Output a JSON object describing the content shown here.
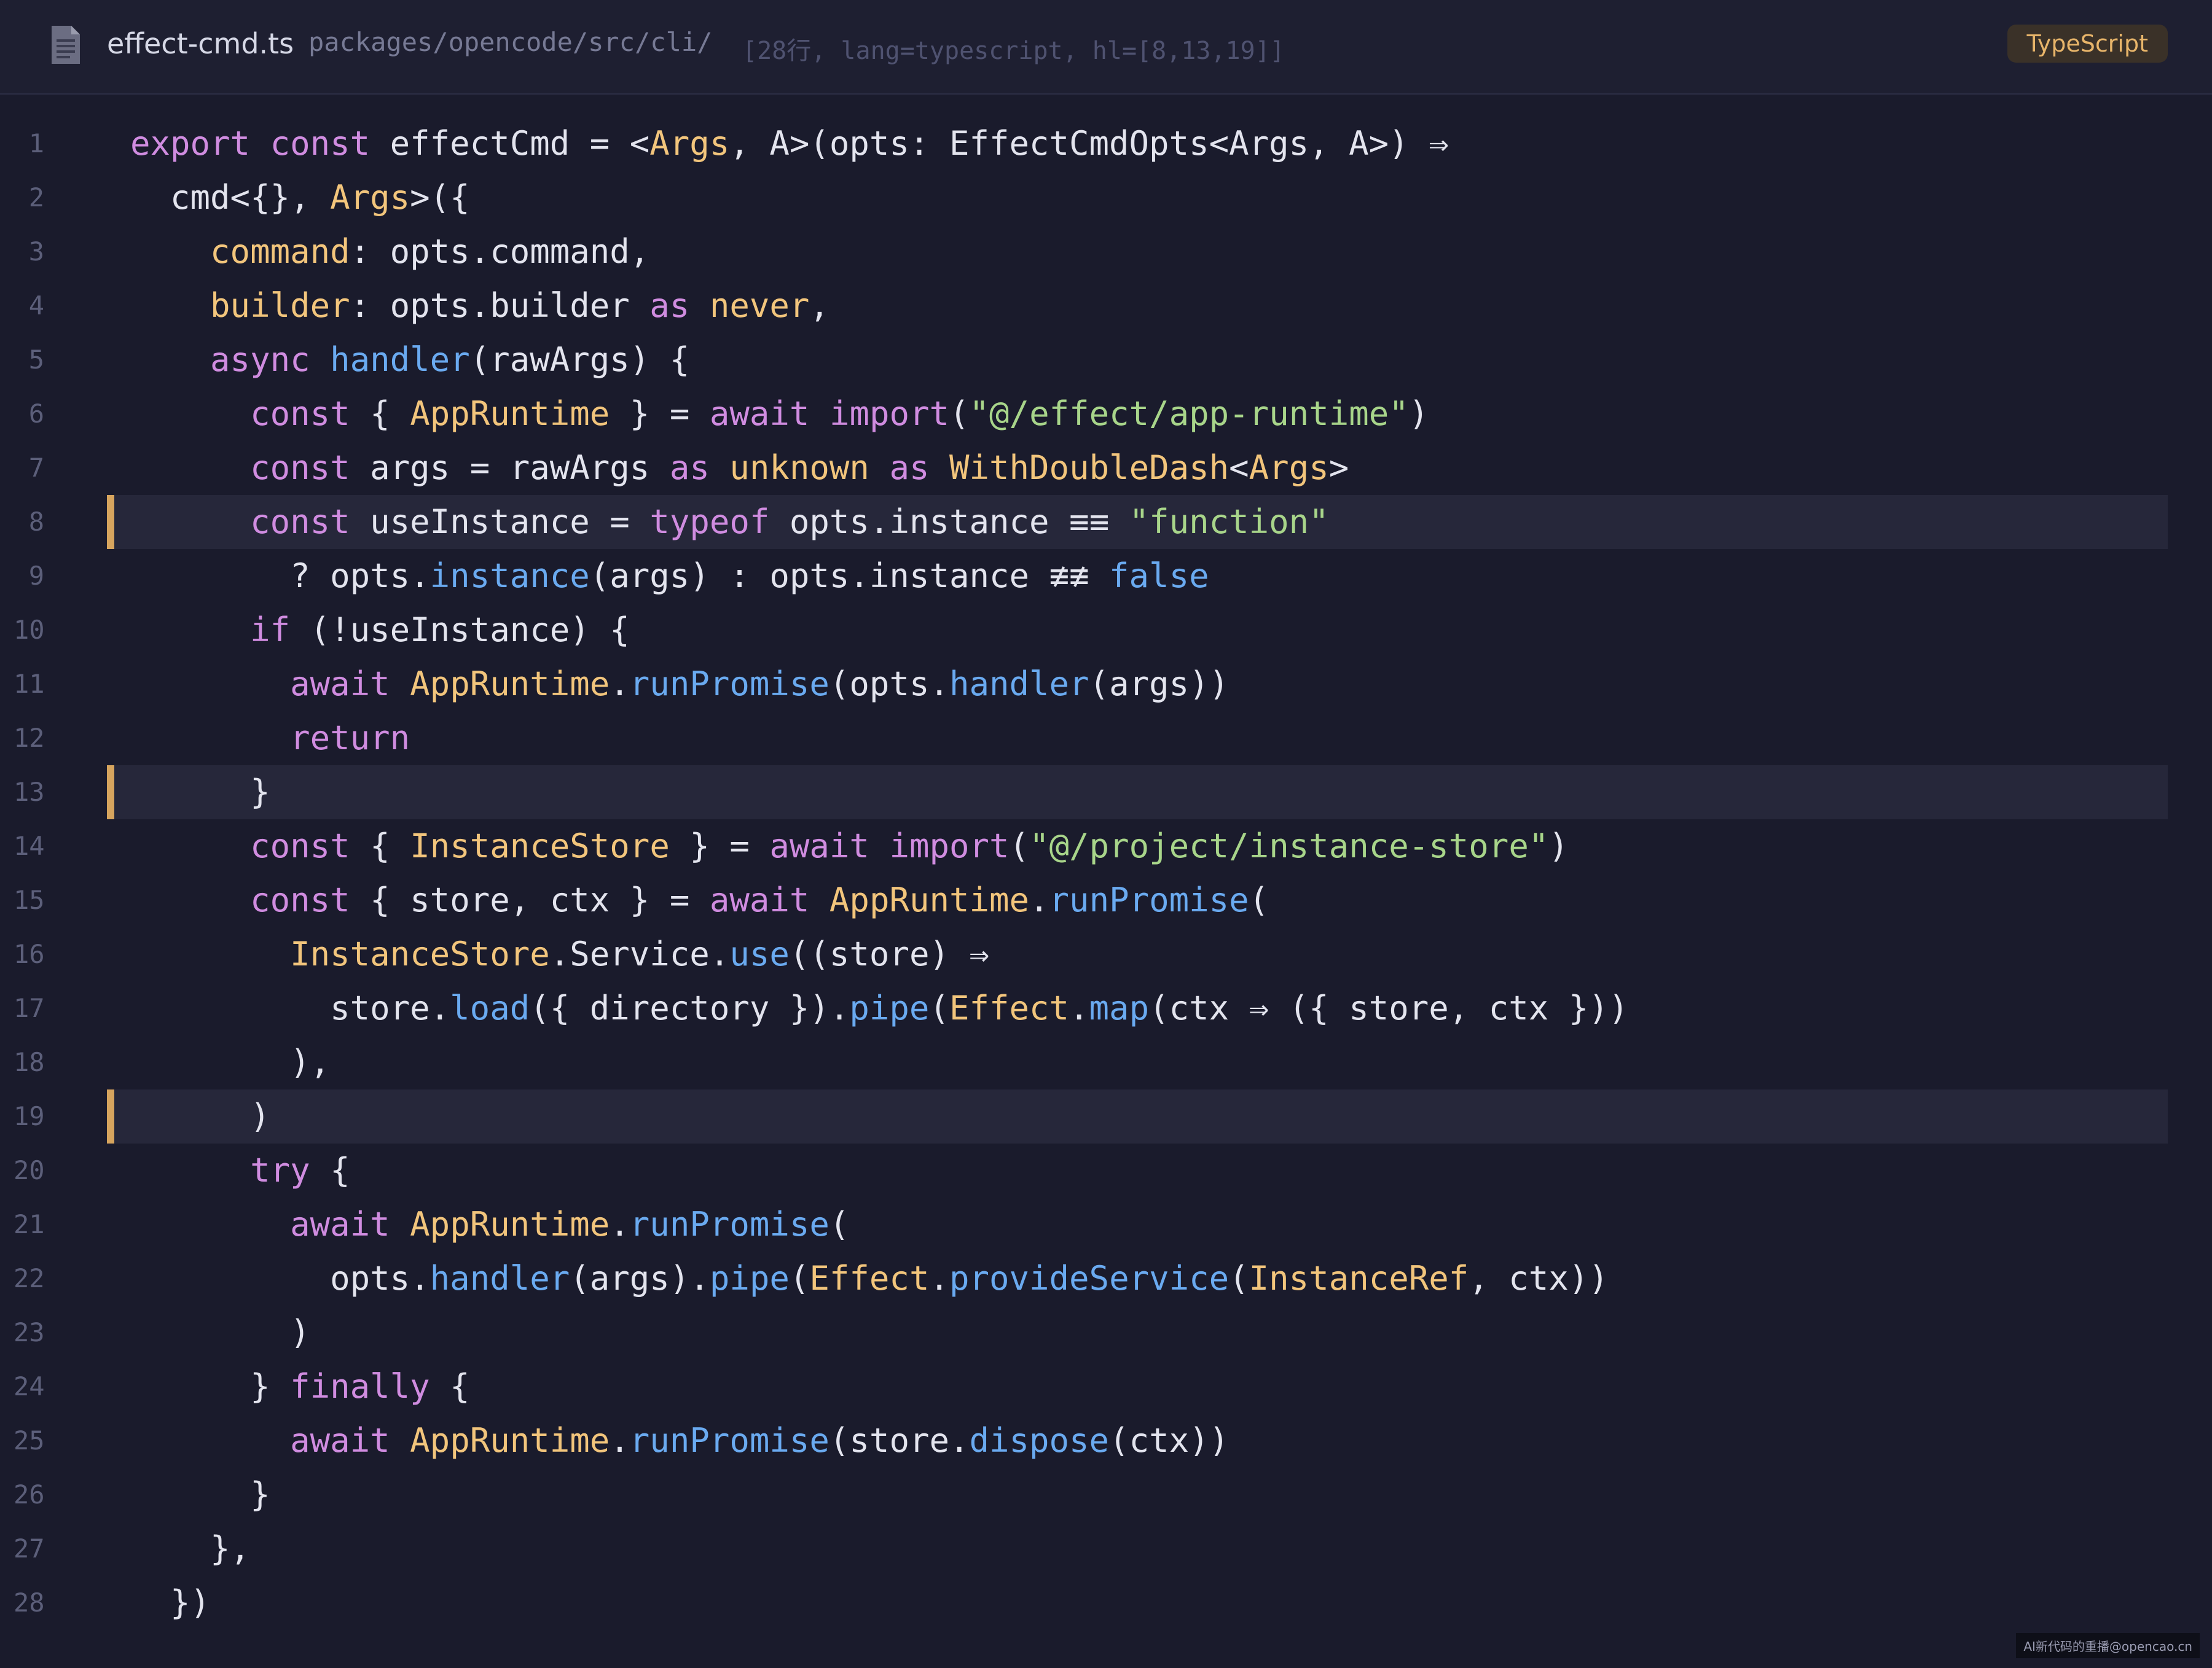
{
  "header": {
    "file_icon": "file-icon",
    "file_name": "effect-cmd.ts",
    "path": "packages/opencode/src/cli/",
    "meta": "[28行, lang=typescript, hl=[8,13,19]]",
    "language": "TypeScript"
  },
  "colors": {
    "background": "#1a1b2c",
    "keyword": "#d08ce0",
    "type": "#f2c57c",
    "function": "#6aaaf0",
    "string": "#a8d58a",
    "highlight_bar": "#d7a55e"
  },
  "highlighted_lines": [
    8,
    13,
    19
  ],
  "lines": [
    [
      [
        "export const ",
        "k"
      ],
      [
        "effectCmd = <",
        "c"
      ],
      [
        "Args",
        "t"
      ],
      [
        ", A>(opts: EffectCmdOpts<Args, A>) ⇒",
        "c"
      ]
    ],
    [
      [
        "  cmd<{}, ",
        "c"
      ],
      [
        "Args",
        "t"
      ],
      [
        ">({",
        "c"
      ]
    ],
    [
      [
        "    ",
        "c"
      ],
      [
        "command",
        "t"
      ],
      [
        ": opts.command,",
        "c"
      ]
    ],
    [
      [
        "    ",
        "c"
      ],
      [
        "builder",
        "t"
      ],
      [
        ": opts.builder ",
        "c"
      ],
      [
        "as",
        "k"
      ],
      [
        " ",
        "c"
      ],
      [
        "never",
        "t"
      ],
      [
        ",",
        "c"
      ]
    ],
    [
      [
        "    ",
        "c"
      ],
      [
        "async",
        "k"
      ],
      [
        " ",
        "c"
      ],
      [
        "handler",
        "f"
      ],
      [
        "(rawArgs) {",
        "c"
      ]
    ],
    [
      [
        "      ",
        "c"
      ],
      [
        "const",
        "k"
      ],
      [
        " { ",
        "c"
      ],
      [
        "AppRuntime",
        "t"
      ],
      [
        " } = ",
        "c"
      ],
      [
        "await",
        "k"
      ],
      [
        " ",
        "c"
      ],
      [
        "import",
        "k"
      ],
      [
        "(",
        "c"
      ],
      [
        "\"@/effect/app-runtime\"",
        "s"
      ],
      [
        ")",
        "c"
      ]
    ],
    [
      [
        "      ",
        "c"
      ],
      [
        "const",
        "k"
      ],
      [
        " args = rawArgs ",
        "c"
      ],
      [
        "as",
        "k"
      ],
      [
        " ",
        "c"
      ],
      [
        "unknown",
        "t"
      ],
      [
        " ",
        "c"
      ],
      [
        "as",
        "k"
      ],
      [
        " ",
        "c"
      ],
      [
        "WithDoubleDash",
        "t"
      ],
      [
        "<",
        "c"
      ],
      [
        "Args",
        "t"
      ],
      [
        ">",
        "c"
      ]
    ],
    [
      [
        "      ",
        "c"
      ],
      [
        "const",
        "k"
      ],
      [
        " useInstance = ",
        "c"
      ],
      [
        "typeof",
        "k"
      ],
      [
        " opts.instance ≡≡ ",
        "c"
      ],
      [
        "\"function\"",
        "s"
      ]
    ],
    [
      [
        "        ? opts.",
        "c"
      ],
      [
        "instance",
        "f"
      ],
      [
        "(args) : opts.instance ≢≢ ",
        "c"
      ],
      [
        "false",
        "f"
      ]
    ],
    [
      [
        "      ",
        "c"
      ],
      [
        "if",
        "k"
      ],
      [
        " (!useInstance) {",
        "c"
      ]
    ],
    [
      [
        "        ",
        "c"
      ],
      [
        "await",
        "k"
      ],
      [
        " ",
        "c"
      ],
      [
        "AppRuntime",
        "t"
      ],
      [
        ".",
        "c"
      ],
      [
        "runPromise",
        "f"
      ],
      [
        "(opts.",
        "c"
      ],
      [
        "handler",
        "f"
      ],
      [
        "(args))",
        "c"
      ]
    ],
    [
      [
        "        ",
        "c"
      ],
      [
        "return",
        "k"
      ]
    ],
    [
      [
        "      }",
        "c"
      ]
    ],
    [
      [
        "      ",
        "c"
      ],
      [
        "const",
        "k"
      ],
      [
        " { ",
        "c"
      ],
      [
        "InstanceStore",
        "t"
      ],
      [
        " } = ",
        "c"
      ],
      [
        "await",
        "k"
      ],
      [
        " ",
        "c"
      ],
      [
        "import",
        "k"
      ],
      [
        "(",
        "c"
      ],
      [
        "\"@/project/instance-store\"",
        "s"
      ],
      [
        ")",
        "c"
      ]
    ],
    [
      [
        "      ",
        "c"
      ],
      [
        "const",
        "k"
      ],
      [
        " { store, ctx } = ",
        "c"
      ],
      [
        "await",
        "k"
      ],
      [
        " ",
        "c"
      ],
      [
        "AppRuntime",
        "t"
      ],
      [
        ".",
        "c"
      ],
      [
        "runPromise",
        "f"
      ],
      [
        "(",
        "c"
      ]
    ],
    [
      [
        "        ",
        "c"
      ],
      [
        "InstanceStore",
        "t"
      ],
      [
        ".Service.",
        "c"
      ],
      [
        "use",
        "f"
      ],
      [
        "((store) ⇒",
        "c"
      ]
    ],
    [
      [
        "          store.",
        "c"
      ],
      [
        "load",
        "f"
      ],
      [
        "({ directory }).",
        "c"
      ],
      [
        "pipe",
        "f"
      ],
      [
        "(",
        "c"
      ],
      [
        "Effect",
        "t"
      ],
      [
        ".",
        "c"
      ],
      [
        "map",
        "f"
      ],
      [
        "(ctx ⇒ ({ store, ctx }))",
        "c"
      ]
    ],
    [
      [
        "        ),",
        "c"
      ]
    ],
    [
      [
        "      )",
        "c"
      ]
    ],
    [
      [
        "      ",
        "c"
      ],
      [
        "try",
        "k"
      ],
      [
        " {",
        "c"
      ]
    ],
    [
      [
        "        ",
        "c"
      ],
      [
        "await",
        "k"
      ],
      [
        " ",
        "c"
      ],
      [
        "AppRuntime",
        "t"
      ],
      [
        ".",
        "c"
      ],
      [
        "runPromise",
        "f"
      ],
      [
        "(",
        "c"
      ]
    ],
    [
      [
        "          opts.",
        "c"
      ],
      [
        "handler",
        "f"
      ],
      [
        "(args).",
        "c"
      ],
      [
        "pipe",
        "f"
      ],
      [
        "(",
        "c"
      ],
      [
        "Effect",
        "t"
      ],
      [
        ".",
        "c"
      ],
      [
        "provideService",
        "f"
      ],
      [
        "(",
        "c"
      ],
      [
        "InstanceRef",
        "t"
      ],
      [
        ", ctx))",
        "c"
      ]
    ],
    [
      [
        "        )",
        "c"
      ]
    ],
    [
      [
        "      } ",
        "c"
      ],
      [
        "finally",
        "k"
      ],
      [
        " {",
        "c"
      ]
    ],
    [
      [
        "        ",
        "c"
      ],
      [
        "await",
        "k"
      ],
      [
        " ",
        "c"
      ],
      [
        "AppRuntime",
        "t"
      ],
      [
        ".",
        "c"
      ],
      [
        "runPromise",
        "f"
      ],
      [
        "(store.",
        "c"
      ],
      [
        "dispose",
        "f"
      ],
      [
        "(ctx))",
        "c"
      ]
    ],
    [
      [
        "      }",
        "c"
      ]
    ],
    [
      [
        "    },",
        "c"
      ]
    ],
    [
      [
        "  })",
        "c"
      ]
    ]
  ],
  "watermark": "AI新代码的重播@opencao.cn"
}
